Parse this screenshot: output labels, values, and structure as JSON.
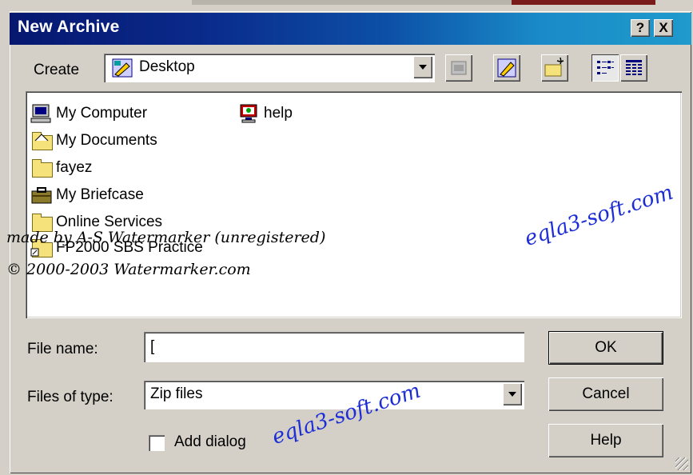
{
  "window": {
    "title": "New Archive"
  },
  "titlebar": {
    "help_label": "?",
    "close_label": "X"
  },
  "create": {
    "label": "Create",
    "location": "Desktop"
  },
  "files": [
    {
      "name": "My Computer",
      "icon": "computer-icon"
    },
    {
      "name": "My Documents",
      "icon": "documents-folder-icon"
    },
    {
      "name": "fayez",
      "icon": "folder-icon"
    },
    {
      "name": "My Briefcase",
      "icon": "briefcase-icon"
    },
    {
      "name": "Online Services",
      "icon": "folder-icon"
    },
    {
      "name": "FP2000 SBS Practice",
      "icon": "folder-shortcut-icon"
    },
    {
      "name": "help",
      "icon": "help-monitor-icon"
    }
  ],
  "filename": {
    "label": "File name:",
    "value": "["
  },
  "filetype": {
    "label": "Files of type:",
    "value": "Zip files"
  },
  "add_dialog": {
    "label": "Add dialog",
    "checked": false
  },
  "buttons": {
    "ok": "OK",
    "cancel": "Cancel",
    "help": "Help"
  },
  "watermarks": {
    "line1": "made by A-S Watermarker (unregistered)",
    "line2": "© 2000-2003 Watermarker.com",
    "site": "eqla3-soft.com"
  }
}
